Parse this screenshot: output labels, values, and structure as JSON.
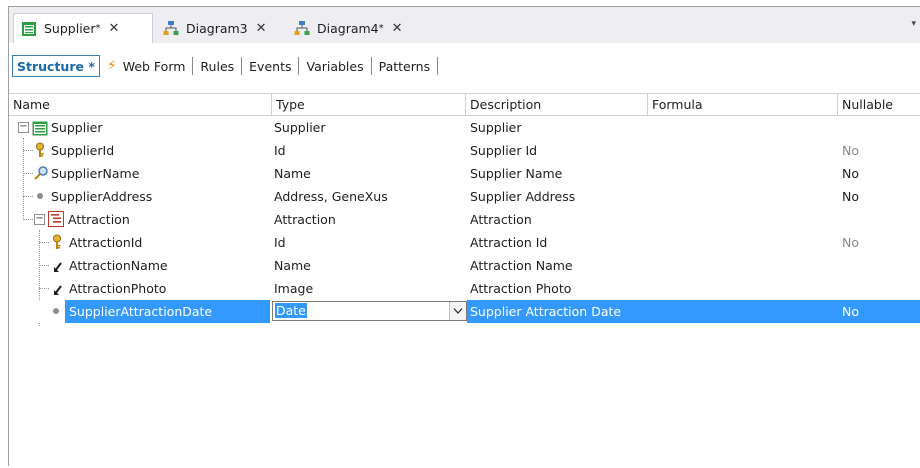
{
  "tabs": [
    {
      "label": "Supplier",
      "modified": "*",
      "close": "✕",
      "icon": "transaction-icon",
      "active": true
    },
    {
      "label": "Diagram3",
      "modified": "",
      "close": "✕",
      "icon": "diagram-icon",
      "active": false
    },
    {
      "label": "Diagram4",
      "modified": "*",
      "close": "✕",
      "icon": "diagram-icon",
      "active": false
    }
  ],
  "tab_overflow": "▾",
  "subtabs": [
    "Structure *",
    "Web Form",
    "Rules",
    "Events",
    "Variables",
    "Patterns"
  ],
  "columns": {
    "name": "Name",
    "type": "Type",
    "description": "Description",
    "formula": "Formula",
    "nullable": "Nullable"
  },
  "rows": [
    {
      "name": "Supplier",
      "type": "Supplier",
      "description": "Supplier",
      "nullable": "",
      "icon": "transaction-icon"
    },
    {
      "name": "SupplierId",
      "type": "Id",
      "description": "Supplier Id",
      "nullable": "No",
      "icon": "key-icon"
    },
    {
      "name": "SupplierName",
      "type": "Name",
      "description": "Supplier Name",
      "nullable": "No",
      "icon": "search-key-icon"
    },
    {
      "name": "SupplierAddress",
      "type": "Address, GeneXus",
      "description": "Supplier Address",
      "nullable": "No",
      "icon": "dot-icon"
    },
    {
      "name": "Attraction",
      "type": "Attraction",
      "description": "Attraction",
      "nullable": "",
      "icon": "level-icon"
    },
    {
      "name": "AttractionId",
      "type": "Id",
      "description": "Attraction Id",
      "nullable": "No",
      "icon": "key-icon"
    },
    {
      "name": "AttractionName",
      "type": "Name",
      "description": "Attraction Name",
      "nullable": "",
      "icon": "inferred-arrow-icon"
    },
    {
      "name": "AttractionPhoto",
      "type": "Image",
      "description": "Attraction Photo",
      "nullable": "",
      "icon": "inferred-arrow-icon"
    },
    {
      "name": "SupplierAttractionDate",
      "type": "Date",
      "description": "Supplier Attraction Date",
      "nullable": "No",
      "icon": "dot-icon"
    }
  ],
  "colors": {
    "selection": "#3399ff",
    "active_subtab": "#1c6aa8",
    "bolt": "#f08c1a"
  }
}
